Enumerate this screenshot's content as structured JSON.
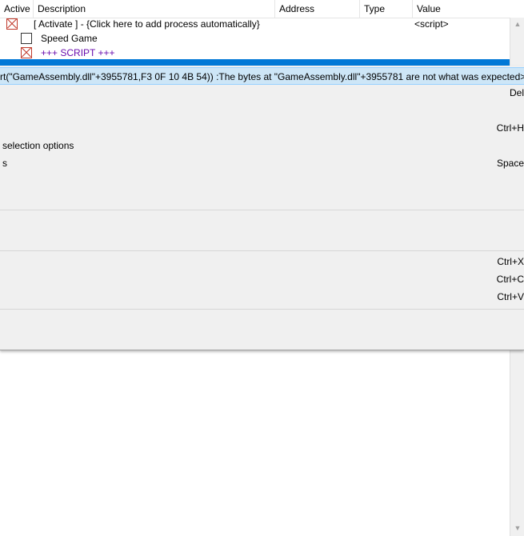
{
  "table": {
    "columns": {
      "active": "Active",
      "description": "Description",
      "address": "Address",
      "type": "Type",
      "value": "Value"
    },
    "rows": [
      {
        "description": "[ Activate ] - {Click here to add process automatically}",
        "value": "<script>"
      },
      {
        "description": "Speed Game",
        "value": ""
      },
      {
        "description": "+++ SCRIPT +++",
        "value": ""
      }
    ]
  },
  "context_menu": {
    "error_item": "rt(\"GameAssembly.dll\"+3955781,F3 0F 10 4B 54)) :The bytes at \"GameAssembly.dll\"+3955781 are not what was expected>>",
    "items": [
      {
        "label": "",
        "shortcut": "Del"
      },
      {
        "label": "",
        "shortcut": ""
      },
      {
        "label": "",
        "shortcut": "Ctrl+H"
      },
      {
        "label": "selection options",
        "shortcut": ""
      },
      {
        "label": "s",
        "shortcut": "Space"
      },
      {
        "label": "Ctrl+X",
        "shortcut": "Ctrl+X"
      },
      {
        "label": "Ctrl+C",
        "shortcut": "Ctrl+C"
      },
      {
        "label": "Ctrl+V",
        "shortcut": "Ctrl+V"
      }
    ]
  },
  "scrollbar": {
    "up_icon": "▲",
    "down_icon": "▼"
  }
}
